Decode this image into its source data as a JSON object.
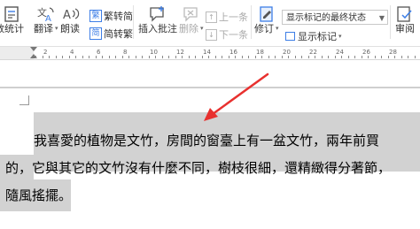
{
  "ribbon": {
    "buttons": [
      {
        "id": "word-count",
        "label": "数统计",
        "icon": "word-count-icon"
      },
      {
        "id": "translate",
        "label": "翻译",
        "icon": "translate-icon"
      },
      {
        "id": "read-aloud",
        "label": "朗读",
        "icon": "read-aloud-icon"
      }
    ],
    "trad_to_simp": "繁转简",
    "simp_to_trad": "简转繁",
    "insert_comment": "插入批注",
    "delete": "删除",
    "prev_item": "上一条",
    "next_item": "下一条",
    "revise": "修订",
    "markup_view_select": "显示标记的最终状态",
    "show_markup": "显示标记",
    "review_partial": "审阅"
  },
  "ruler": {
    "numbers": [
      "2",
      "4",
      "6",
      "8",
      "10",
      "12",
      "14",
      "16",
      "18",
      "20",
      "22",
      "24",
      "26",
      "28"
    ]
  },
  "document": {
    "lines": [
      "我喜愛的植物是文竹，房間的窗臺上有一盆文竹，兩年前買",
      "的，它與其它的文竹沒有什麼不同，樹枝很細，還精緻得分著節，",
      "隨風搖擺。"
    ]
  },
  "colors": {
    "selection_highlight": "#d2d2d2",
    "arrow": "#e8312f",
    "ribbon_icon_blue": "#3d7ee6"
  }
}
